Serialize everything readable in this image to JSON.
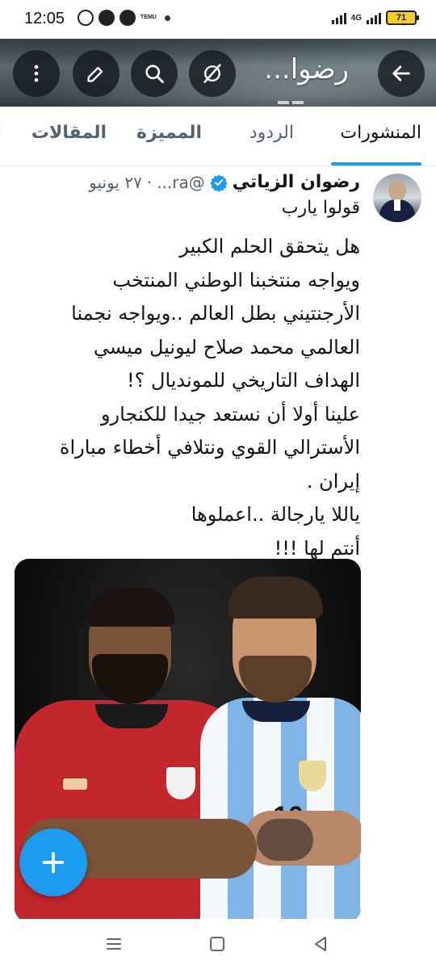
{
  "status_bar": {
    "time": "12:05",
    "notification_icons": [
      "whatsapp-icon",
      "facebook-icon",
      "messenger-icon",
      "temu-icon"
    ],
    "temu_label": "TEMU",
    "network": "4G",
    "battery": "71"
  },
  "header": {
    "title": "رضوا...",
    "buttons": [
      "more-icon",
      "edit-icon",
      "search-icon",
      "grok-icon",
      "back-arrow-icon"
    ]
  },
  "tabs": [
    {
      "label": "المنشورات",
      "active": true
    },
    {
      "label": "الردود",
      "active": false
    },
    {
      "label": "المميزة",
      "active": false
    },
    {
      "label": "المقالات",
      "active": false
    },
    {
      "label": "ا",
      "active": false
    }
  ],
  "tweet": {
    "author_name": "رضوان الزياتي",
    "handle": "@ra...",
    "separator": "·",
    "date": "٢٧ يونيو",
    "verified": true,
    "first_line": "قولوا يارب",
    "body_lines": [
      "هل يتحقق الحلم الكبير",
      "ويواجه منتخبنا الوطني المنتخب",
      "الأرجنتيني  بطل العالم ..ويواجه نجمنا",
      "العالمي محمد صلاح  ليونيل ميسي",
      "الهداف التاريخي للمونديال ؟!",
      "علينا أولا أن نستعد جيدا للكنجارو",
      "الأسترالي القوي ونتلافي أخطاء مباراة",
      "إيران .",
      "ياللا يارجالة  ..اعملوها",
      "أنتم لها !!!"
    ],
    "photo_jersey_numbers": [
      "10",
      "10"
    ]
  },
  "fab": {
    "icon": "plus-icon"
  },
  "nav_bar": {
    "buttons": [
      "recents-icon",
      "home-icon",
      "back-icon"
    ]
  },
  "colors": {
    "accent": "#1d9bf0",
    "text": "#0f1419",
    "secondary": "#536471",
    "battery": "#f6cc2e"
  }
}
